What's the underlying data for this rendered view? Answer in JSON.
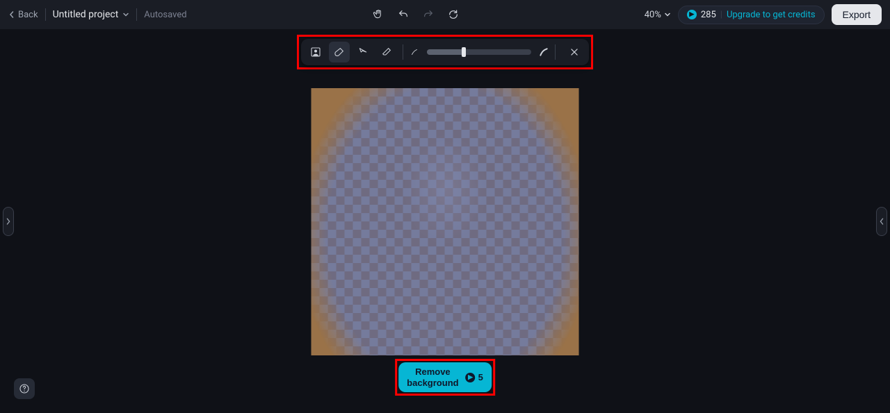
{
  "header": {
    "back_label": "Back",
    "project_name": "Untitled project",
    "autosaved_label": "Autosaved",
    "zoom_level": "40%",
    "credits_count": "285",
    "upgrade_label": "Upgrade to get credits",
    "export_label": "Export"
  },
  "toolbar": {
    "slider_value": 35
  },
  "action_button": {
    "label_line1": "Remove",
    "label_line2": "background",
    "cost": "5"
  }
}
